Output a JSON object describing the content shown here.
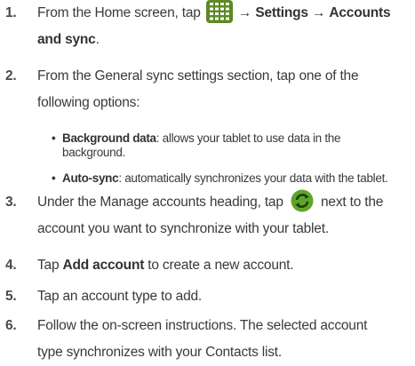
{
  "steps": [
    {
      "number": "1.",
      "text_a": "From the Home screen, tap",
      "arrow1": "→",
      "settings": "Settings",
      "arrow2": "→",
      "accounts": "Accounts",
      "and_sync": "and sync",
      "end": "."
    },
    {
      "number": "2.",
      "line1": "From the General sync settings section, tap one of the",
      "line2": "following options:"
    },
    {
      "number": "3.",
      "text_a": "Under the Manage accounts heading, tap",
      "text_b": "next to the",
      "line2": "account you want to synchronize with your tablet."
    },
    {
      "number": "4.",
      "text_a": "Tap",
      "bold": "Add account",
      "text_b": "to create a new account."
    },
    {
      "number": "5.",
      "text": "Tap an account type to add."
    },
    {
      "number": "6.",
      "line1": "Follow the on-screen instructions. The selected account",
      "line2": "type synchronizes with your Contacts list."
    }
  ],
  "options": [
    {
      "bullet": "•",
      "title": "Background data",
      "desc_line1": ": allows your tablet to use data in the",
      "desc_line2": "background."
    },
    {
      "bullet": "•",
      "title": "Auto-sync",
      "desc_line1": ": automatically synchronizes your data with the tablet."
    }
  ],
  "icons": {
    "apps": "apps-grid-icon",
    "sync": "sync-icon"
  },
  "colors": {
    "icon_green": "#5c8a23",
    "sync_green": "#5fa52a",
    "text": "#3a3a3a"
  }
}
